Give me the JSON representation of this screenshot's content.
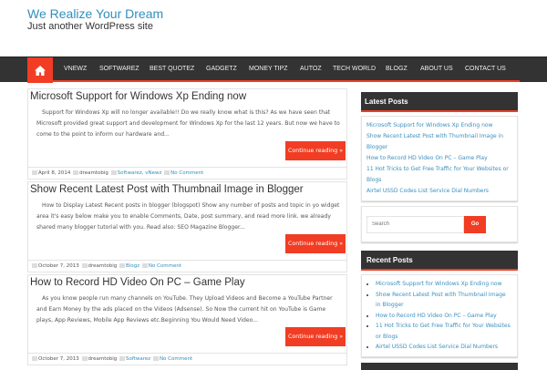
{
  "site": {
    "title": "We Realize Your Dream",
    "tagline": "Just another WordPress site"
  },
  "nav": {
    "items": [
      "VNEWZ",
      "SOFTWAREZ",
      "BEST QUOTEZ",
      "GADGETZ",
      "MONEY TIPZ",
      "AUTOZ",
      "TECH WORLD",
      "BLOGZ",
      "ABOUT US",
      "CONTACT US"
    ]
  },
  "posts": [
    {
      "title": "Microsoft Support for Windows Xp Ending now",
      "excerpt": "Support for Windows Xp will no longer available!! Do we really know what is this? As we have seen that Microsoft provided great support and development for Windows Xp for the last 12 years. But now we have to come to the point to inform our hardware and...",
      "button": "Continue reading »",
      "date": "April 8, 2014",
      "author": "dreamtobig",
      "categories": "Softwarez, vNewz",
      "comments": "No Comment"
    },
    {
      "title": "Show Recent Latest Post with Thumbnail Image in Blogger",
      "excerpt": "How to Display Latest Recent posts in blogger (blogspot) Show any number of posts and topic in yo widget area it's easy below make you to enable Comments, Date, post summary, and read more link. we already shared many blogger tutorial with you. Read also: SEO Magazine Blogger...",
      "button": "Continue reading »",
      "date": "October 7, 2013",
      "author": "dreamtobig",
      "categories": "Blogz",
      "comments": "No Comment"
    },
    {
      "title": "How to Record HD Video On PC – Game Play",
      "excerpt": "As you know people run many channels on YouTube. They Upload Videos and Become a YouTube Partner and Earn Money by the ads placed on the Videos (Adsense). So Now the current hit on YouTube is Game plays, App Reviews, Mobile App Reviews etc.Beginning You Would Need Video...",
      "button": "Continue reading »",
      "date": "October 7, 2013",
      "author": "dreamtobig",
      "categories": "Softwarez",
      "comments": "No Comment"
    }
  ],
  "sidebar": {
    "latest": {
      "title": "Latest Posts",
      "items": [
        "Microsoft Support for Windows Xp Ending now",
        "Show Recent Latest Post with Thumbnail Image in Blogger",
        "How to Record HD Video On PC – Game Play",
        "11 Hot Tricks to Get Free Traffic for Your Websites or Blogs",
        "Airtel USSD Codes List Service Dial Numbers"
      ]
    },
    "search": {
      "placeholder": "Search",
      "button": "Go"
    },
    "recent": {
      "title": "Recent Posts",
      "items": [
        "Microsoft Support for Windows Xp Ending now",
        "Show Recent Latest Post with Thumbnail Image in Blogger",
        "How to Record HD Video On PC – Game Play",
        "11 Hot Tricks to Get Free Traffic for Your Websites or Blogs",
        "Airtel USSD Codes List Service Dial Numbers"
      ]
    }
  }
}
